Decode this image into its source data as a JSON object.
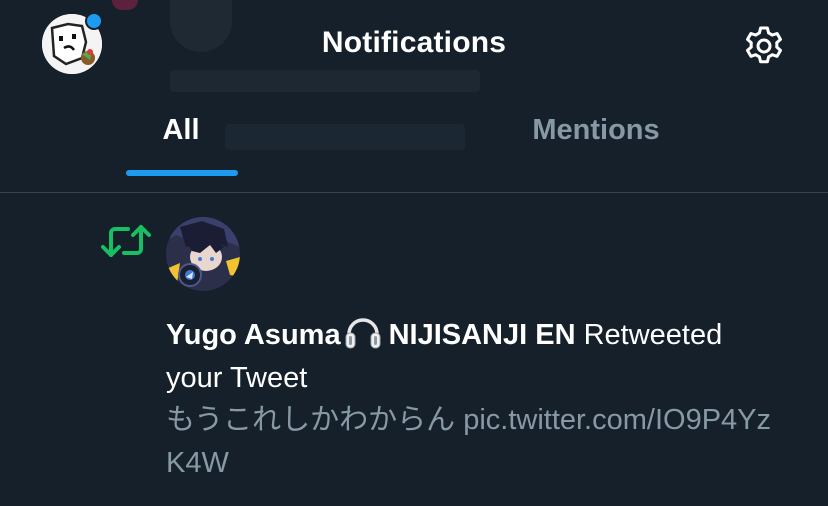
{
  "header": {
    "title": "Notifications",
    "avatar_icon": "user-avatar-icon",
    "settings_icon": "gear-icon",
    "has_unread_badge": true
  },
  "tabs": [
    {
      "label": "All",
      "selected": true
    },
    {
      "label": "Mentions",
      "selected": false
    }
  ],
  "notification": {
    "type_icon": "retweet-icon",
    "user_name_part1": "Yugo Asuma",
    "user_name_emoji": "headphones-icon",
    "user_name_part2": "NIJISANJI EN",
    "action_line1": "Retweeted",
    "action_line2": "your Tweet",
    "tweet_text": "もうこれしかわからん pic.twitter.com/IO9P4YzK4W"
  },
  "colors": {
    "background": "#15202b",
    "accent": "#1d9bf0",
    "retweet_green": "#17bf63",
    "secondary_text": "#8899a6",
    "divider": "#38444d"
  }
}
